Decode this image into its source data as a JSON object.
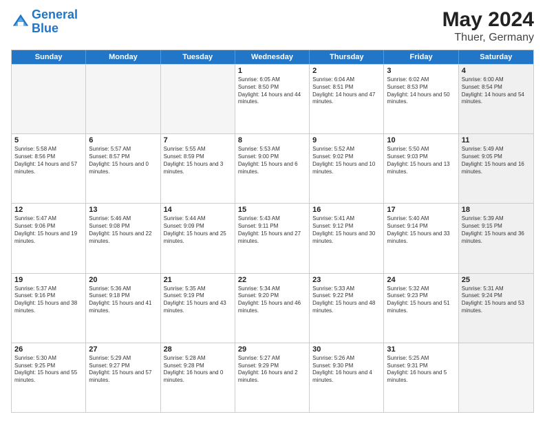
{
  "header": {
    "logo_line1": "General",
    "logo_line2": "Blue",
    "title": "May 2024",
    "subtitle": "Thuer, Germany"
  },
  "days_of_week": [
    "Sunday",
    "Monday",
    "Tuesday",
    "Wednesday",
    "Thursday",
    "Friday",
    "Saturday"
  ],
  "rows": [
    [
      {
        "day": "",
        "empty": true
      },
      {
        "day": "",
        "empty": true
      },
      {
        "day": "",
        "empty": true
      },
      {
        "day": "1",
        "sunrise": "6:05 AM",
        "sunset": "8:50 PM",
        "daylight": "14 hours and 44 minutes."
      },
      {
        "day": "2",
        "sunrise": "6:04 AM",
        "sunset": "8:51 PM",
        "daylight": "14 hours and 47 minutes."
      },
      {
        "day": "3",
        "sunrise": "6:02 AM",
        "sunset": "8:53 PM",
        "daylight": "14 hours and 50 minutes."
      },
      {
        "day": "4",
        "sunrise": "6:00 AM",
        "sunset": "8:54 PM",
        "daylight": "14 hours and 54 minutes.",
        "shaded": true
      }
    ],
    [
      {
        "day": "5",
        "sunrise": "5:58 AM",
        "sunset": "8:56 PM",
        "daylight": "14 hours and 57 minutes."
      },
      {
        "day": "6",
        "sunrise": "5:57 AM",
        "sunset": "8:57 PM",
        "daylight": "15 hours and 0 minutes."
      },
      {
        "day": "7",
        "sunrise": "5:55 AM",
        "sunset": "8:59 PM",
        "daylight": "15 hours and 3 minutes."
      },
      {
        "day": "8",
        "sunrise": "5:53 AM",
        "sunset": "9:00 PM",
        "daylight": "15 hours and 6 minutes."
      },
      {
        "day": "9",
        "sunrise": "5:52 AM",
        "sunset": "9:02 PM",
        "daylight": "15 hours and 10 minutes."
      },
      {
        "day": "10",
        "sunrise": "5:50 AM",
        "sunset": "9:03 PM",
        "daylight": "15 hours and 13 minutes."
      },
      {
        "day": "11",
        "sunrise": "5:49 AM",
        "sunset": "9:05 PM",
        "daylight": "15 hours and 16 minutes.",
        "shaded": true
      }
    ],
    [
      {
        "day": "12",
        "sunrise": "5:47 AM",
        "sunset": "9:06 PM",
        "daylight": "15 hours and 19 minutes."
      },
      {
        "day": "13",
        "sunrise": "5:46 AM",
        "sunset": "9:08 PM",
        "daylight": "15 hours and 22 minutes."
      },
      {
        "day": "14",
        "sunrise": "5:44 AM",
        "sunset": "9:09 PM",
        "daylight": "15 hours and 25 minutes."
      },
      {
        "day": "15",
        "sunrise": "5:43 AM",
        "sunset": "9:11 PM",
        "daylight": "15 hours and 27 minutes."
      },
      {
        "day": "16",
        "sunrise": "5:41 AM",
        "sunset": "9:12 PM",
        "daylight": "15 hours and 30 minutes."
      },
      {
        "day": "17",
        "sunrise": "5:40 AM",
        "sunset": "9:14 PM",
        "daylight": "15 hours and 33 minutes."
      },
      {
        "day": "18",
        "sunrise": "5:39 AM",
        "sunset": "9:15 PM",
        "daylight": "15 hours and 36 minutes.",
        "shaded": true
      }
    ],
    [
      {
        "day": "19",
        "sunrise": "5:37 AM",
        "sunset": "9:16 PM",
        "daylight": "15 hours and 38 minutes."
      },
      {
        "day": "20",
        "sunrise": "5:36 AM",
        "sunset": "9:18 PM",
        "daylight": "15 hours and 41 minutes."
      },
      {
        "day": "21",
        "sunrise": "5:35 AM",
        "sunset": "9:19 PM",
        "daylight": "15 hours and 43 minutes."
      },
      {
        "day": "22",
        "sunrise": "5:34 AM",
        "sunset": "9:20 PM",
        "daylight": "15 hours and 46 minutes."
      },
      {
        "day": "23",
        "sunrise": "5:33 AM",
        "sunset": "9:22 PM",
        "daylight": "15 hours and 48 minutes."
      },
      {
        "day": "24",
        "sunrise": "5:32 AM",
        "sunset": "9:23 PM",
        "daylight": "15 hours and 51 minutes."
      },
      {
        "day": "25",
        "sunrise": "5:31 AM",
        "sunset": "9:24 PM",
        "daylight": "15 hours and 53 minutes.",
        "shaded": true
      }
    ],
    [
      {
        "day": "26",
        "sunrise": "5:30 AM",
        "sunset": "9:25 PM",
        "daylight": "15 hours and 55 minutes."
      },
      {
        "day": "27",
        "sunrise": "5:29 AM",
        "sunset": "9:27 PM",
        "daylight": "15 hours and 57 minutes."
      },
      {
        "day": "28",
        "sunrise": "5:28 AM",
        "sunset": "9:28 PM",
        "daylight": "16 hours and 0 minutes."
      },
      {
        "day": "29",
        "sunrise": "5:27 AM",
        "sunset": "9:29 PM",
        "daylight": "16 hours and 2 minutes."
      },
      {
        "day": "30",
        "sunrise": "5:26 AM",
        "sunset": "9:30 PM",
        "daylight": "16 hours and 4 minutes."
      },
      {
        "day": "31",
        "sunrise": "5:25 AM",
        "sunset": "9:31 PM",
        "daylight": "16 hours and 5 minutes."
      },
      {
        "day": "",
        "empty": true,
        "shaded": true
      }
    ]
  ]
}
